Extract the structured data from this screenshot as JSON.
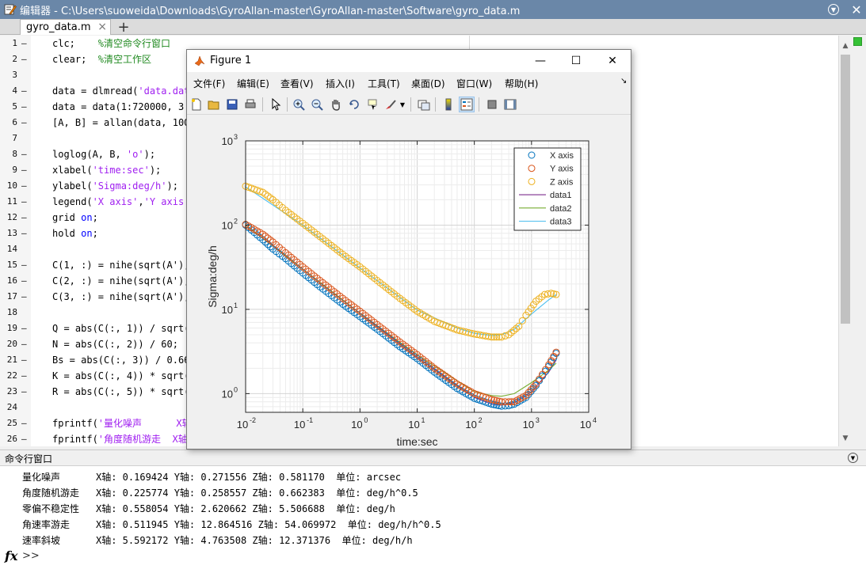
{
  "editor": {
    "title": "编辑器 - C:\\Users\\suoweida\\Downloads\\GyroAllan-master\\GyroAllan-master\\Software\\gyro_data.m",
    "tab_label": "gyro_data.m",
    "tab_close": "×",
    "tab_add": "+",
    "close": "✕",
    "dash": "–"
  },
  "code_lines": [
    {
      "n": "1",
      "dash": true,
      "parts": [
        [
          "",
          "clc;    "
        ],
        [
          "cmt",
          "%清空命令行窗口"
        ]
      ]
    },
    {
      "n": "2",
      "dash": true,
      "parts": [
        [
          "",
          "clear;  "
        ],
        [
          "cmt",
          "%清空工作区"
        ]
      ]
    },
    {
      "n": "3",
      "dash": false,
      "parts": []
    },
    {
      "n": "4",
      "dash": true,
      "parts": [
        [
          "",
          "data = dlmread("
        ],
        [
          "str",
          "'data.dat'"
        ]
      ]
    },
    {
      "n": "5",
      "dash": true,
      "parts": [
        [
          "",
          "data = data(1:720000, 3:"
        ]
      ]
    },
    {
      "n": "6",
      "dash": true,
      "parts": [
        [
          "",
          "[A, B] = allan(data, 100,"
        ]
      ]
    },
    {
      "n": "7",
      "dash": false,
      "parts": []
    },
    {
      "n": "8",
      "dash": true,
      "parts": [
        [
          "",
          "loglog(A, B, "
        ],
        [
          "str",
          "'o'"
        ],
        [
          "",
          ");"
        ]
      ]
    },
    {
      "n": "9",
      "dash": true,
      "parts": [
        [
          "",
          "xlabel("
        ],
        [
          "str",
          "'time:sec'"
        ],
        [
          "",
          ");"
        ]
      ]
    },
    {
      "n": "10",
      "dash": true,
      "parts": [
        [
          "",
          "ylabel("
        ],
        [
          "str",
          "'Sigma:deg/h'"
        ],
        [
          "",
          ");"
        ]
      ]
    },
    {
      "n": "11",
      "dash": true,
      "parts": [
        [
          "",
          "legend("
        ],
        [
          "str",
          "'X axis'"
        ],
        [
          "",
          ","
        ],
        [
          "str",
          "'Y axis'"
        ],
        [
          "",
          ","
        ]
      ]
    },
    {
      "n": "12",
      "dash": true,
      "parts": [
        [
          "",
          "grid "
        ],
        [
          "kw",
          "on"
        ],
        [
          "",
          ";"
        ]
      ]
    },
    {
      "n": "13",
      "dash": true,
      "parts": [
        [
          "",
          "hold "
        ],
        [
          "kw",
          "on"
        ],
        [
          "",
          ";"
        ]
      ]
    },
    {
      "n": "14",
      "dash": false,
      "parts": []
    },
    {
      "n": "15",
      "dash": true,
      "parts": [
        [
          "",
          "C(1, :) = nihe(sqrt(A'),"
        ]
      ]
    },
    {
      "n": "16",
      "dash": true,
      "parts": [
        [
          "",
          "C(2, :) = nihe(sqrt(A'),"
        ]
      ]
    },
    {
      "n": "17",
      "dash": true,
      "parts": [
        [
          "",
          "C(3, :) = nihe(sqrt(A'),"
        ]
      ]
    },
    {
      "n": "18",
      "dash": false,
      "parts": []
    },
    {
      "n": "19",
      "dash": true,
      "parts": [
        [
          "",
          "Q = abs(C(:, 1)) / sqrt(3"
        ]
      ]
    },
    {
      "n": "20",
      "dash": true,
      "parts": [
        [
          "",
          "N = abs(C(:, 2)) / 60;"
        ]
      ]
    },
    {
      "n": "21",
      "dash": true,
      "parts": [
        [
          "",
          "Bs = abs(C(:, 3)) / 0.664"
        ]
      ]
    },
    {
      "n": "22",
      "dash": true,
      "parts": [
        [
          "",
          "K = abs(C(:, 4)) * sqrt(3"
        ]
      ]
    },
    {
      "n": "23",
      "dash": true,
      "parts": [
        [
          "",
          "R = abs(C(:, 5)) * sqrt(2"
        ]
      ]
    },
    {
      "n": "24",
      "dash": false,
      "parts": []
    },
    {
      "n": "25",
      "dash": true,
      "parts": [
        [
          "",
          "fprintf("
        ],
        [
          "str",
          "'量化噪声      X轴"
        ]
      ]
    },
    {
      "n": "26",
      "dash": true,
      "parts": [
        [
          "",
          "fprintf("
        ],
        [
          "str",
          "'角度随机游走  X轴"
        ]
      ]
    }
  ],
  "command_window": {
    "title": "命令行窗口",
    "prompt": "fx",
    "chevron": ">>",
    "lines": [
      {
        "label": "量化噪声",
        "values": "X轴: 0.169424 Y轴: 0.271556 Z轴: 0.581170  单位: arcsec"
      },
      {
        "label": "角度随机游走",
        "values": "X轴: 0.225774 Y轴: 0.258557 Z轴: 0.662383  单位: deg/h^0.5"
      },
      {
        "label": "零偏不稳定性",
        "values": "X轴: 0.558054 Y轴: 2.620662 Z轴: 5.506688  单位: deg/h"
      },
      {
        "label": "角速率游走",
        "values": "X轴: 0.511945 Y轴: 12.864516 Z轴: 54.069972  单位: deg/h/h^0.5"
      },
      {
        "label": "速率斜坡",
        "values": "X轴: 5.592172 Y轴: 4.763508 Z轴: 12.371376  单位: deg/h/h"
      }
    ]
  },
  "figure": {
    "title": "Figure 1",
    "minimize": "—",
    "maximize": "☐",
    "close": "✕",
    "menu": [
      "文件(F)",
      "编辑(E)",
      "查看(V)",
      "插入(I)",
      "工具(T)",
      "桌面(D)",
      "窗口(W)",
      "帮助(H)"
    ],
    "dock_arrow": "↘"
  },
  "colors": {
    "x_series": "#0072bd",
    "y_series": "#d95319",
    "z_series": "#edb120",
    "data1": "#7e2f8e",
    "data2": "#77ac30",
    "data3": "#4dbeee"
  },
  "chart_data": {
    "type": "scatter",
    "xlabel": "time:sec",
    "ylabel": "Sigma:deg/h",
    "xscale": "log",
    "yscale": "log",
    "xlim": [
      0.01,
      10000
    ],
    "ylim": [
      0.6,
      1000
    ],
    "xticks": [
      0.01,
      0.1,
      1,
      10,
      100,
      1000,
      10000
    ],
    "xtick_exponents": [
      "-2",
      "-1",
      "0",
      "1",
      "2",
      "3",
      "4"
    ],
    "yticks": [
      1,
      10,
      100,
      1000
    ],
    "ytick_exponents": [
      "0",
      "1",
      "2",
      "3"
    ],
    "grid": true,
    "legend_position": "top-right",
    "series": [
      {
        "name": "X axis",
        "style": "marker",
        "points": [
          [
            0.01,
            100
          ],
          [
            0.02,
            67
          ],
          [
            0.03,
            52
          ],
          [
            0.05,
            40
          ],
          [
            0.1,
            27
          ],
          [
            0.2,
            18.5
          ],
          [
            0.5,
            11.5
          ],
          [
            1,
            8.2
          ],
          [
            2,
            5.8
          ],
          [
            5,
            3.6
          ],
          [
            10,
            2.6
          ],
          [
            20,
            1.8
          ],
          [
            50,
            1.15
          ],
          [
            100,
            0.88
          ],
          [
            200,
            0.75
          ],
          [
            300,
            0.71
          ],
          [
            400,
            0.72
          ],
          [
            500,
            0.75
          ],
          [
            800,
            0.9
          ],
          [
            1200,
            1.25
          ],
          [
            2000,
            2.1
          ],
          [
            2700,
            3
          ]
        ]
      },
      {
        "name": "Y axis",
        "style": "marker",
        "points": [
          [
            0.01,
            102
          ],
          [
            0.02,
            78
          ],
          [
            0.03,
            63
          ],
          [
            0.05,
            47
          ],
          [
            0.1,
            32
          ],
          [
            0.2,
            22
          ],
          [
            0.5,
            13.5
          ],
          [
            1,
            9.5
          ],
          [
            2,
            6.6
          ],
          [
            5,
            4.1
          ],
          [
            10,
            2.9
          ],
          [
            20,
            2
          ],
          [
            50,
            1.3
          ],
          [
            100,
            1
          ],
          [
            200,
            0.85
          ],
          [
            300,
            0.8
          ],
          [
            400,
            0.8
          ],
          [
            500,
            0.8
          ],
          [
            800,
            0.95
          ],
          [
            1200,
            1.3
          ],
          [
            2000,
            2.2
          ],
          [
            2700,
            3.1
          ]
        ]
      },
      {
        "name": "Z axis",
        "style": "marker",
        "points": [
          [
            0.01,
            290
          ],
          [
            0.02,
            245
          ],
          [
            0.03,
            200
          ],
          [
            0.05,
            150
          ],
          [
            0.1,
            105
          ],
          [
            0.2,
            73
          ],
          [
            0.5,
            45
          ],
          [
            1,
            32
          ],
          [
            2,
            22
          ],
          [
            5,
            13.5
          ],
          [
            10,
            9.5
          ],
          [
            20,
            7.2
          ],
          [
            50,
            5.7
          ],
          [
            100,
            5.1
          ],
          [
            200,
            4.7
          ],
          [
            300,
            4.7
          ],
          [
            400,
            5
          ],
          [
            600,
            6.3
          ],
          [
            800,
            8.5
          ],
          [
            1200,
            12.5
          ],
          [
            1700,
            15
          ],
          [
            2200,
            15.5
          ],
          [
            2700,
            15
          ]
        ]
      },
      {
        "name": "data1",
        "style": "line",
        "points": [
          [
            0.01,
            100
          ],
          [
            0.1,
            30
          ],
          [
            1,
            9
          ],
          [
            10,
            2.7
          ],
          [
            50,
            1.25
          ],
          [
            100,
            0.9
          ],
          [
            200,
            0.75
          ],
          [
            300,
            0.73
          ],
          [
            500,
            0.78
          ],
          [
            1000,
            1.05
          ],
          [
            2000,
            1.8
          ],
          [
            2700,
            2.5
          ]
        ]
      },
      {
        "name": "data2",
        "style": "line",
        "points": [
          [
            0.01,
            100
          ],
          [
            0.1,
            30
          ],
          [
            1,
            9
          ],
          [
            10,
            2.9
          ],
          [
            100,
            1.05
          ],
          [
            200,
            0.95
          ],
          [
            300,
            0.93
          ],
          [
            500,
            1
          ],
          [
            1000,
            1.35
          ],
          [
            2000,
            1.9
          ],
          [
            2700,
            2.3
          ]
        ]
      },
      {
        "name": "data3",
        "style": "line",
        "points": [
          [
            0.01,
            285
          ],
          [
            0.1,
            100
          ],
          [
            1,
            31
          ],
          [
            10,
            9.8
          ],
          [
            50,
            6
          ],
          [
            100,
            5.2
          ],
          [
            200,
            4.9
          ],
          [
            300,
            5
          ],
          [
            500,
            5.8
          ],
          [
            1000,
            8.8
          ],
          [
            2000,
            13
          ],
          [
            2700,
            15
          ]
        ]
      }
    ]
  }
}
